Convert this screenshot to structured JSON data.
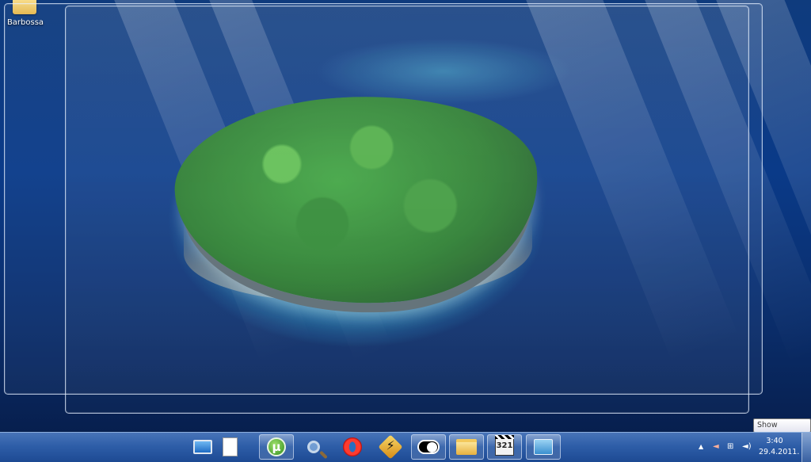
{
  "desktop": {
    "icons": [
      {
        "label": "Barbossa",
        "icon": "folder-icon"
      }
    ]
  },
  "tooltip": {
    "text": "Show desktop"
  },
  "taskbar": {
    "items": [
      {
        "name": "desktop-monitor",
        "icon": "monitor-icon",
        "pinned": false
      },
      {
        "name": "document",
        "icon": "page-icon",
        "pinned": false
      },
      {
        "name": "utorrent",
        "icon": "utorrent-icon",
        "glyph": "µ",
        "pinned": true
      },
      {
        "name": "search",
        "icon": "magnifier-icon",
        "pinned": false
      },
      {
        "name": "opera",
        "icon": "opera-icon",
        "pinned": false
      },
      {
        "name": "winamp",
        "icon": "winamp-icon",
        "pinned": false
      },
      {
        "name": "eclipse",
        "icon": "eclipse-icon",
        "pinned": true
      },
      {
        "name": "explorer",
        "icon": "folder-icon",
        "pinned": true
      },
      {
        "name": "media-player",
        "icon": "clapperboard-icon",
        "glyph": "321",
        "pinned": true
      },
      {
        "name": "remote-desktop",
        "icon": "remote-desktop-icon",
        "pinned": true
      }
    ],
    "tray": {
      "expand": "▲",
      "volume_muted": "◄",
      "network": "⊞",
      "volume": "◄)"
    },
    "clock": {
      "time": "3:40",
      "date": "29.4.2011."
    }
  },
  "colors": {
    "taskbar_top": "#4874b8",
    "taskbar_bottom": "#1d4a93",
    "sea": "#0a3a88"
  }
}
